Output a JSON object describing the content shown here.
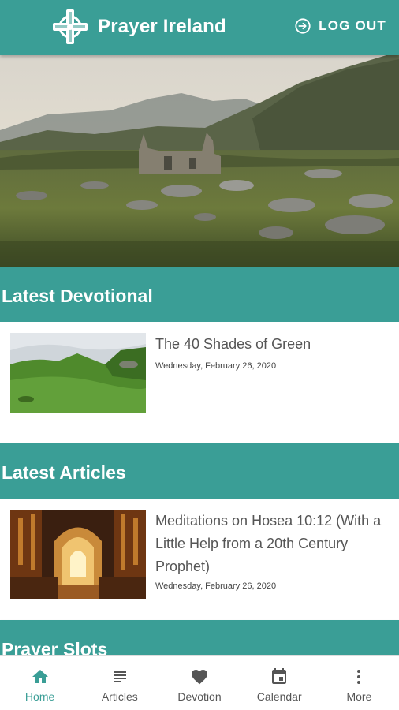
{
  "app_bar": {
    "title": "Prayer Ireland",
    "logout_label": "LOG OUT",
    "background": "#3a9e96"
  },
  "sections": {
    "devotional": {
      "heading": "Latest Devotional",
      "item": {
        "title": "The 40 Shades of Green",
        "date": "Wednesday, February 26, 2020"
      }
    },
    "articles": {
      "heading": "Latest Articles",
      "item": {
        "title": "Meditations on Hosea 10:12 (With a Little Help from a 20th Century Prophet)",
        "date": "Wednesday, February 26, 2020"
      }
    },
    "prayer_slots": {
      "heading": "Prayer Slots"
    }
  },
  "bottom_nav": {
    "items": [
      {
        "label": "Home",
        "icon": "home-icon",
        "active": true
      },
      {
        "label": "Articles",
        "icon": "articles-icon",
        "active": false
      },
      {
        "label": "Devotion",
        "icon": "heart-icon",
        "active": false
      },
      {
        "label": "Calendar",
        "icon": "calendar-icon",
        "active": false
      },
      {
        "label": "More",
        "icon": "more-vertical-icon",
        "active": false
      }
    ],
    "active_color": "#3a9e96",
    "inactive_color": "#555555"
  }
}
